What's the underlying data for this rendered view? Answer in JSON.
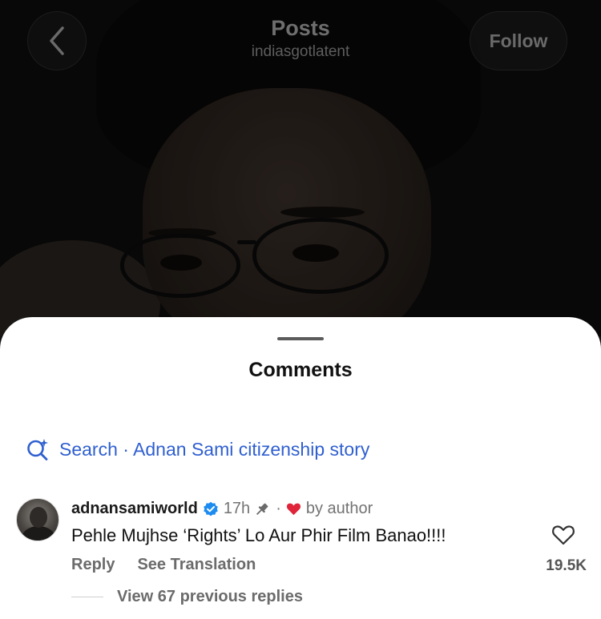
{
  "header": {
    "title": "Posts",
    "username": "indiasgotlatent",
    "follow_label": "Follow"
  },
  "sheet": {
    "title": "Comments",
    "search_text": "Search · Adnan Sami citizenship story"
  },
  "comment": {
    "username": "adnansamiworld",
    "verified": true,
    "time": "17h",
    "separator": "·",
    "by_author": "by author",
    "text": "Pehle Mujhse ‘Rights’ Lo Aur Phir Film Banao!!!!",
    "reply_label": "Reply",
    "translation_label": "See Translation",
    "like_count": "19.5K",
    "view_replies_label": "View 67 previous replies"
  },
  "colors": {
    "accent_blue": "#2f5fd0",
    "verified_blue": "#1d8cf0",
    "heart_red": "#e0243a"
  },
  "icons": [
    "back-chevron-icon",
    "search-sparkle-icon",
    "verified-badge-icon",
    "pin-icon",
    "heart-icon",
    "like-heart-icon"
  ]
}
